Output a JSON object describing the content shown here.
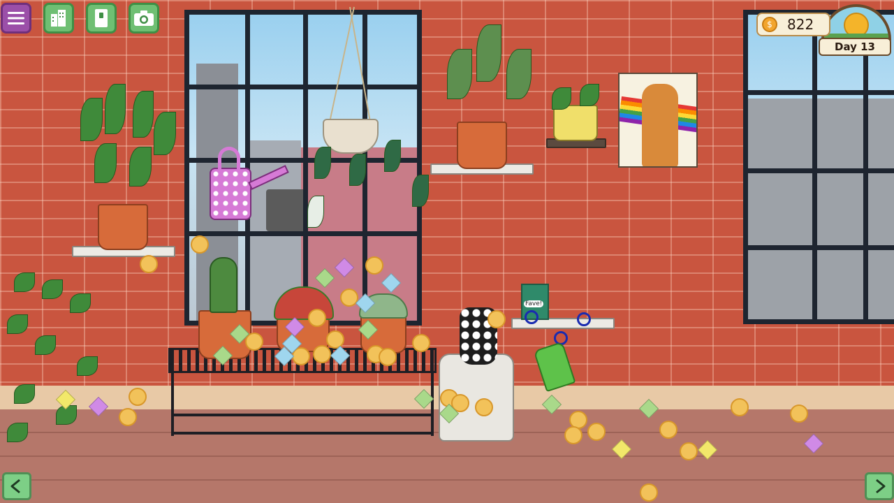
{
  "hud": {
    "coins": "822",
    "day": "Day 13"
  },
  "toolbar": {
    "menu_icon": "hamburger-icon",
    "buildings_icon": "buildings-icon",
    "journal_icon": "journal-icon",
    "camera_icon": "camera-icon"
  },
  "navigation": {
    "prev_icon": "arrow-left-icon",
    "next_icon": "arrow-right-icon"
  },
  "seed_packet": {
    "label": "Fave!"
  },
  "colors": {
    "brick": "#c9553f",
    "menu_purple": "#9b4fa8",
    "toolbar_green": "#6fbf73",
    "coin_gold": "#f2c25a"
  }
}
